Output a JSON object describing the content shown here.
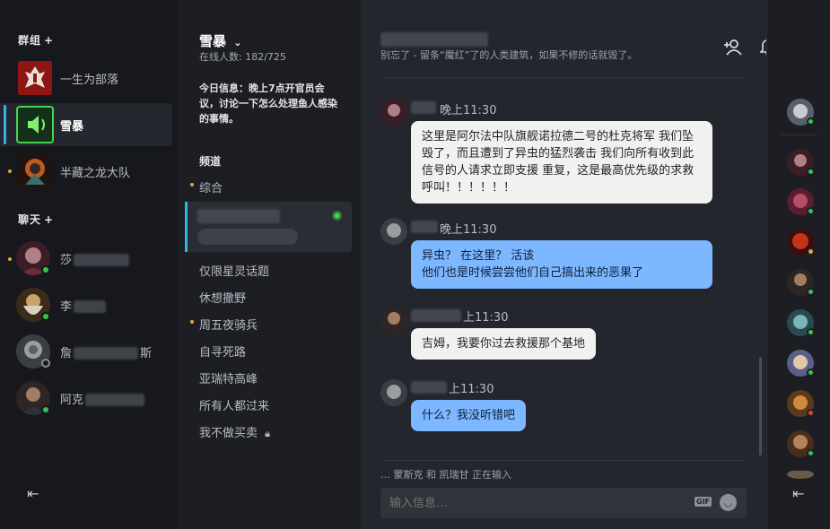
{
  "groups_header": {
    "label": "群组",
    "plus": "+"
  },
  "groups": [
    {
      "label": "一生为部落",
      "icon": "horde-icon"
    },
    {
      "label": "雪暴",
      "icon": "speaker-icon"
    },
    {
      "label": "半藏之龙大队",
      "icon": "dragon-icon"
    }
  ],
  "chat_header": {
    "label": "聊天",
    "plus": "+"
  },
  "dms": [
    {
      "label": "莎"
    },
    {
      "label": "李"
    },
    {
      "label": "詹",
      "suffix": "斯"
    },
    {
      "label": "阿克"
    }
  ],
  "server": {
    "name": "雪暴",
    "online": "在线人数: 182/725",
    "daily_info": "今日信息：晚上7点开官员会议，讨论一下怎么处理鱼人感染的事情。",
    "section_label": "频道",
    "channels": [
      "综合",
      "仅限星灵话题",
      "休想撒野",
      "周五夜骑兵",
      "自寻死路",
      "亚瑞特高峰",
      "所有人都过来",
      "我不做买卖"
    ]
  },
  "main": {
    "topic": "别忘了 - 留条“魔红”了的人类建筑，如果不修的话就毁了。",
    "messages": [
      {
        "time": "晚上11:30",
        "text": "这里是阿尔法中队旗舰诺拉德二号的杜克将军   我们坠毁了，而且遭到了异虫的猛烈袭击   我们向所有收到此信号的人请求立即支援   重复，这是最高优先级的求救呼叫！！！！！！",
        "style": "white"
      },
      {
        "time": "晚上11:30",
        "text": "异虫？ 在这里？ 活该\n他们也是时候尝尝他们自己搞出来的恶果了",
        "style": "blue"
      },
      {
        "time": "上11:30",
        "text": "吉姆，我要你过去救援那个基地",
        "style": "white"
      },
      {
        "time": "上11:30",
        "text": "什么？我没听错吧",
        "style": "blue"
      }
    ],
    "typing": "… 蒙斯克 和 凯瑞甘 正在输入",
    "input_placeholder": "输入信息…",
    "gif_label": "GIF"
  },
  "colors": {
    "accent": "#2fb6e7",
    "online": "#37c64b",
    "unread": "#e8a33a",
    "bubble_blue": "#7cb7ff"
  }
}
